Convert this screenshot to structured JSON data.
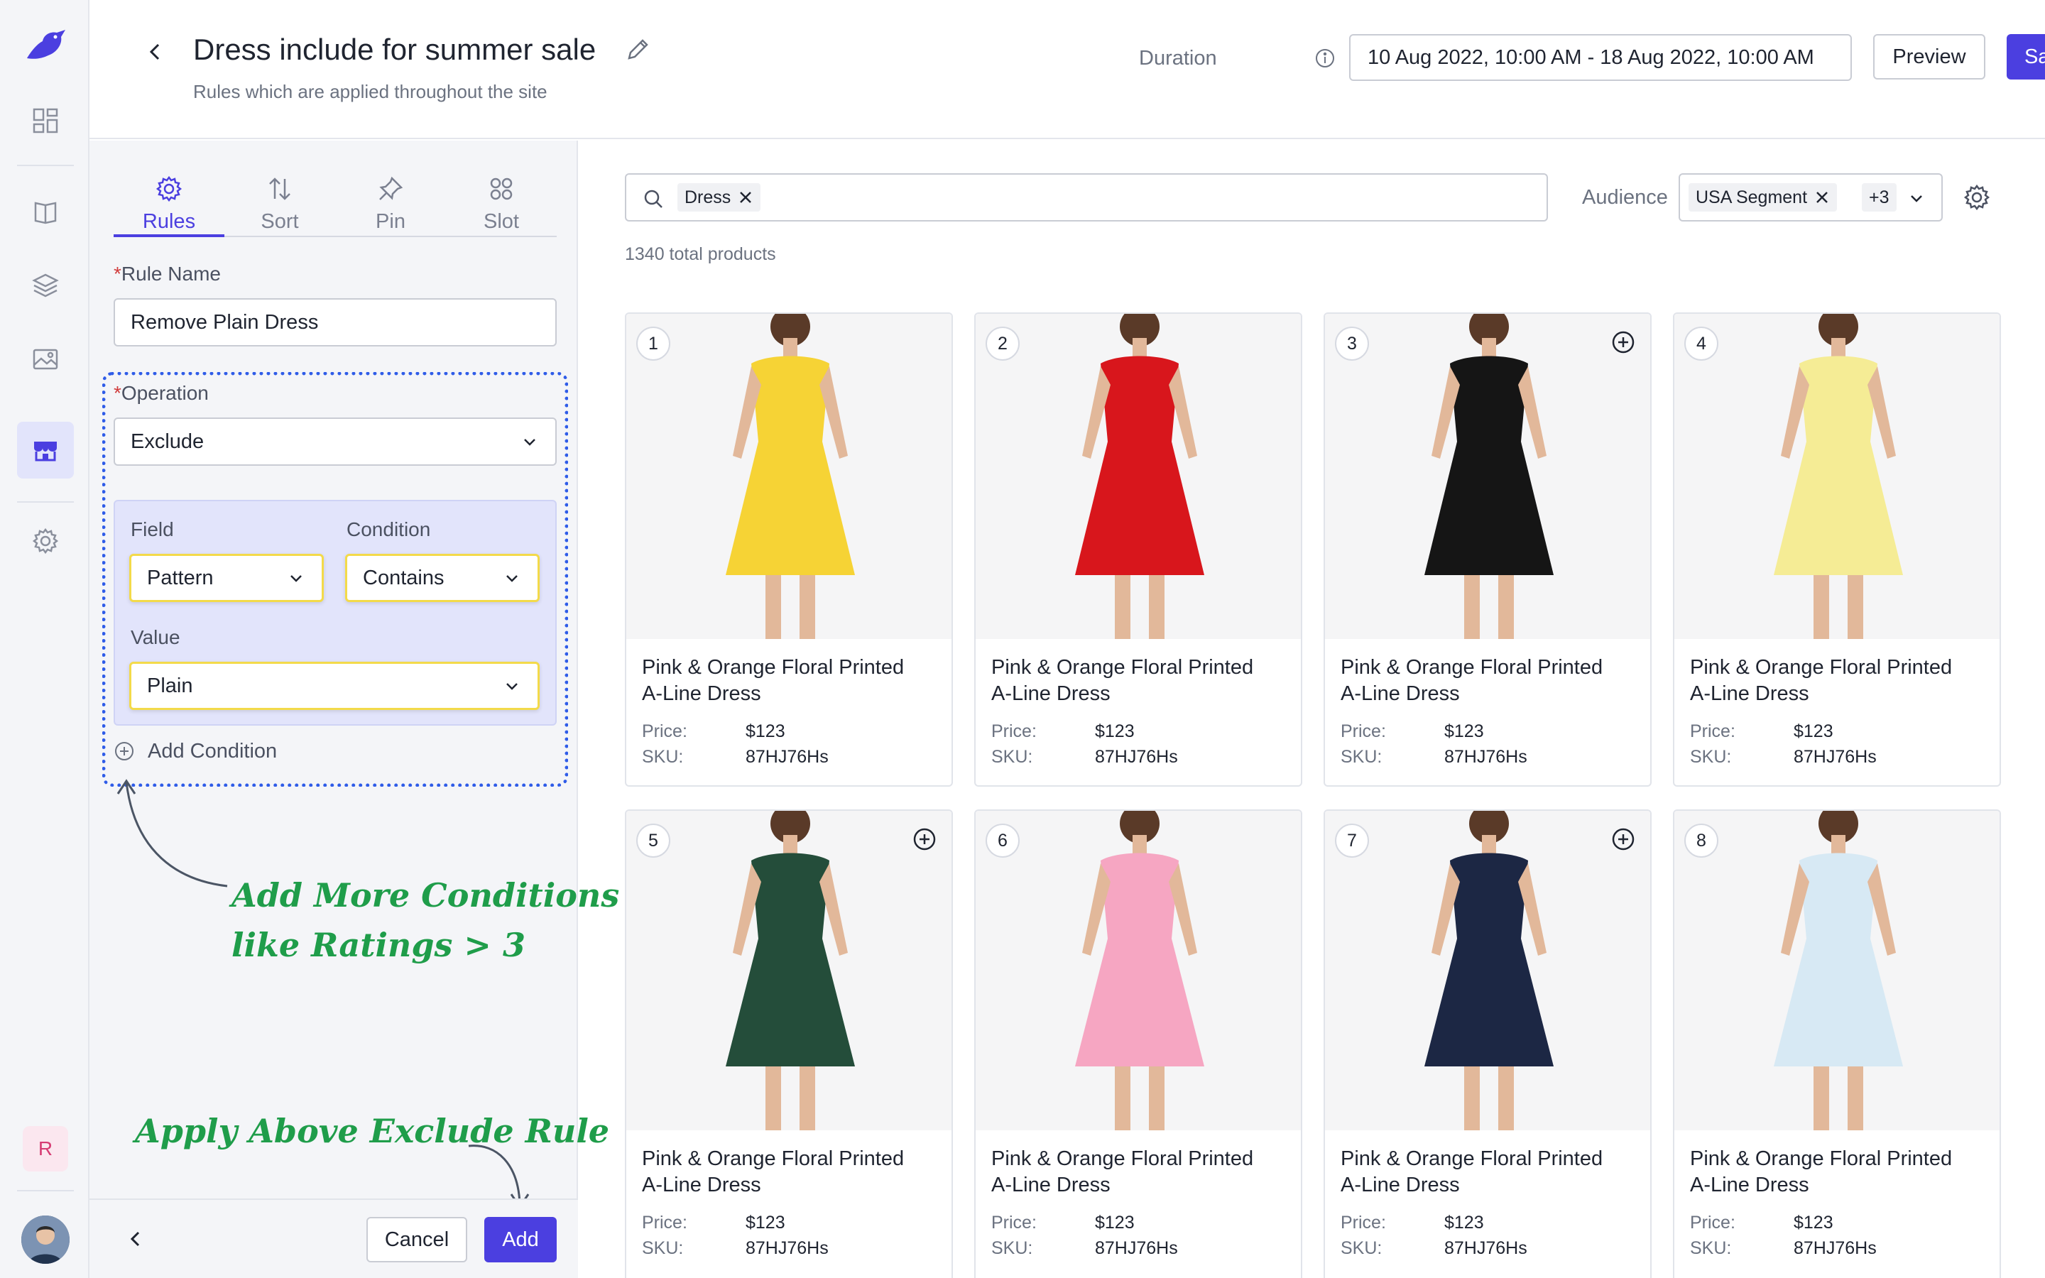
{
  "header": {
    "title": "Dress include for summer sale",
    "subtitle": "Rules which are applied throughout the site",
    "duration_label": "Duration",
    "duration_value": "10 Aug 2022, 10:00 AM  -  18 Aug 2022, 10:00 AM",
    "preview_label": "Preview",
    "save_label": "Save"
  },
  "sidebar": {
    "items": [
      "dashboard",
      "catalog",
      "layers",
      "media",
      "storefront",
      "settings"
    ],
    "active": "storefront",
    "user_initial": "R"
  },
  "rules_panel": {
    "tabs": [
      {
        "label": "Rules",
        "icon": "gear-icon"
      },
      {
        "label": "Sort",
        "icon": "sort-icon"
      },
      {
        "label": "Pin",
        "icon": "pin-icon"
      },
      {
        "label": "Slot",
        "icon": "slot-icon"
      }
    ],
    "active_tab": "Rules",
    "rule_name_label": "Rule Name",
    "rule_name_value": "Remove Plain Dress",
    "operation_label": "Operation",
    "operation_value": "Exclude",
    "field_label": "Field",
    "field_value": "Pattern",
    "condition_label": "Condition",
    "condition_value": "Contains",
    "value_label": "Value",
    "value_value": "Plain",
    "add_condition_label": "Add Condition",
    "cancel_label": "Cancel",
    "add_label": "Add"
  },
  "annotations": {
    "conditions_line1": "Add More Conditions",
    "conditions_line2": "like Ratings > 3",
    "apply": "Apply Above Exclude Rule",
    "color": "#1f9d4a"
  },
  "main": {
    "search_chip": "Dress",
    "audience_label": "Audience",
    "audience_chip": "USA Segment",
    "audience_more": "+3",
    "total_products": "1340 total products",
    "price_label": "Price:",
    "sku_label": "SKU:",
    "products": [
      {
        "num": "1",
        "name1": "Pink & Orange Floral Printed",
        "name2": "A-Line Dress",
        "price": "$123",
        "sku": "87HJ76Hs",
        "dress_color": "#f6d335",
        "pinnable": false
      },
      {
        "num": "2",
        "name1": "Pink & Orange Floral Printed",
        "name2": "A-Line Dress",
        "price": "$123",
        "sku": "87HJ76Hs",
        "dress_color": "#d8161c",
        "pinnable": false
      },
      {
        "num": "3",
        "name1": "Pink & Orange Floral Printed",
        "name2": "A-Line Dress",
        "price": "$123",
        "sku": "87HJ76Hs",
        "dress_color": "#151515",
        "pinnable": true
      },
      {
        "num": "4",
        "name1": "Pink & Orange Floral Printed",
        "name2": "A-Line Dress",
        "price": "$123",
        "sku": "87HJ76Hs",
        "dress_color": "#f5ec95",
        "pinnable": false
      },
      {
        "num": "5",
        "name1": "Pink & Orange Floral Printed",
        "name2": "A-Line Dress",
        "price": "$123",
        "sku": "87HJ76Hs",
        "dress_color": "#244d3a",
        "pinnable": true
      },
      {
        "num": "6",
        "name1": "Pink & Orange Floral Printed",
        "name2": "A-Line Dress",
        "price": "$123",
        "sku": "87HJ76Hs",
        "dress_color": "#f6a6c2",
        "pinnable": false
      },
      {
        "num": "7",
        "name1": "Pink & Orange Floral Printed",
        "name2": "A-Line Dress",
        "price": "$123",
        "sku": "87HJ76Hs",
        "dress_color": "#1c2744",
        "pinnable": true
      },
      {
        "num": "8",
        "name1": "Pink & Orange Floral Printed",
        "name2": "A-Line Dress",
        "price": "$123",
        "sku": "87HJ76Hs",
        "dress_color": "#d7e9f4",
        "pinnable": false
      }
    ]
  },
  "colors": {
    "accent": "#4b3fe0",
    "highlight_border": "#f3da4a",
    "dotted_border": "#2f5ce8",
    "condition_bg": "#e2e4fb"
  }
}
